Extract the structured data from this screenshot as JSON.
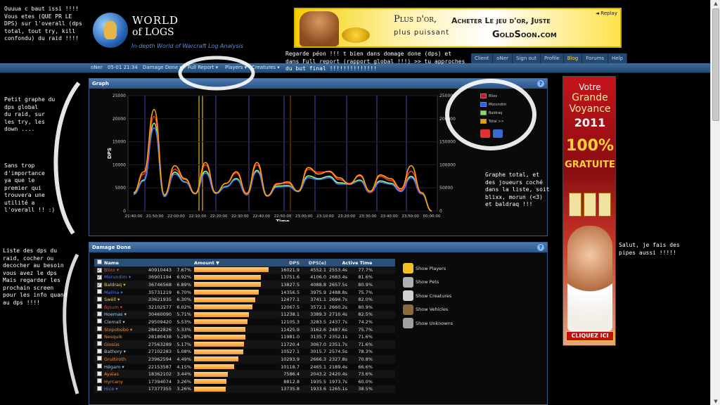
{
  "site": {
    "logo_line1": "WORLD",
    "logo_line2": "of LOGS",
    "tagline": "In-depth World of Warcraft Log Analysis"
  },
  "ad_top": {
    "line1": "Plus d'or,",
    "line2": "plus puissant",
    "line3": "Acheter Le jeu d'or, Juste",
    "line4": "GoldSoon.com",
    "replay": "◄ Replay"
  },
  "top_nav": [
    "Client",
    "oNer",
    "Sign out",
    "Profile",
    "Blog",
    "Forums",
    "Help"
  ],
  "breadcrumb": {
    "user": "oNer",
    "date": "05-01 21:34",
    "damage_done": "Damage Done ▾",
    "full_report": "Full Report ▾",
    "players": "Players ▾",
    "creatures": "Creatures ▾"
  },
  "graph": {
    "title": "Graph",
    "help": "?",
    "legend": [
      "Blixx",
      "Morundim",
      "Baldraq",
      "Total >>"
    ],
    "colors": {
      "Blixx": "#ff3040",
      "Morundim": "#3a7bff",
      "Baldraq": "#9cff70",
      "Total": "#ffa500"
    }
  },
  "chart_data": {
    "type": "line",
    "x": [
      "21:40:00",
      "21:50:00",
      "22:00:00",
      "22:10:00",
      "22:20:00",
      "22:30:00",
      "22:40:00",
      "22:50:00",
      "23:00:00",
      "23:10:00",
      "23:20:00",
      "23:30:00",
      "23:40:00",
      "23:50:00",
      "00:00:00"
    ],
    "xlabel": "Time",
    "ylabel": "DPS",
    "ylim": [
      0,
      25000
    ],
    "yticks": [
      0,
      5000,
      10000,
      15000,
      20000,
      25000
    ],
    "right_ylim": [
      0,
      250000
    ],
    "right_yticks": [
      0,
      50000,
      100000,
      150000,
      200000,
      250000
    ],
    "series": [
      {
        "name": "Total >>",
        "color": "#ffa500",
        "values": [
          4000,
          8500,
          22000,
          3500,
          9800,
          7000,
          3800,
          10500,
          3900,
          6000,
          8500,
          3800,
          10500,
          3300,
          5800,
          6300,
          4300,
          9400,
          8000,
          8600,
          7200,
          5800,
          7800,
          4300,
          7800,
          7000,
          4800,
          9800,
          4000,
          0
        ]
      },
      {
        "name": "Blixx",
        "color": "#ff3040",
        "values": [
          4000,
          8000,
          20500,
          3500,
          9000,
          6800,
          3800,
          10000,
          3900,
          6000,
          8200,
          3600,
          10000,
          3300,
          6000,
          6000,
          4300,
          9000,
          8400,
          8500,
          6800,
          6000,
          7600,
          4100,
          7500,
          6600,
          4500,
          8600,
          3900,
          0
        ]
      },
      {
        "name": "Morundim",
        "color": "#3a7bff",
        "values": [
          3600,
          6500,
          18000,
          3100,
          8000,
          6200,
          3700,
          8200,
          3800,
          5200,
          6800,
          3500,
          8500,
          3200,
          5200,
          5300,
          4200,
          7200,
          6800,
          7200,
          5800,
          5800,
          6500,
          4000,
          6200,
          5800,
          4200,
          7200,
          3700,
          0
        ]
      },
      {
        "name": "Baldraq",
        "color": "#9cff70",
        "values": [
          3700,
          6700,
          19000,
          3200,
          8400,
          6300,
          3700,
          8600,
          3800,
          5300,
          7000,
          3500,
          8800,
          3200,
          5400,
          5500,
          4200,
          7600,
          7000,
          7500,
          6100,
          5900,
          6700,
          4000,
          6500,
          6000,
          4300,
          7500,
          3800,
          0
        ]
      }
    ]
  },
  "damage_done": {
    "title": "Damage Done",
    "help": "?",
    "headers": {
      "name": "Name",
      "amount": "Amount",
      "amount_sort": "▼",
      "dps": "DPS",
      "dpse": "DPS(e)",
      "active": "Active Time"
    },
    "rows": [
      {
        "checked": true,
        "name": "Blixx ▾",
        "color": "#ff4a3a",
        "amount": "40910443",
        "pct": "7.67%",
        "frac": 1.0,
        "dps": "16021.9",
        "dpse": "4552.1",
        "active": "2553.4s",
        "apct": "77.7%"
      },
      {
        "checked": true,
        "name": "Morundim ▾",
        "color": "#4a7cff",
        "amount": "36901194",
        "pct": "6.92%",
        "frac": 0.9,
        "dps": "13751.6",
        "dpse": "4106.0",
        "active": "2683.4s",
        "apct": "81.6%"
      },
      {
        "checked": true,
        "name": "Baldraq ▾",
        "color": "#e0d640",
        "amount": "36746568",
        "pct": "6.89%",
        "frac": 0.9,
        "dps": "13827.5",
        "dpse": "4088.8",
        "active": "2657.5s",
        "apct": "80.9%"
      },
      {
        "checked": false,
        "name": "Malina ▾",
        "color": "#4a7cff",
        "amount": "35731219",
        "pct": "6.70%",
        "frac": 0.87,
        "dps": "14356.5",
        "dpse": "3975.9",
        "active": "2488.8s",
        "apct": "75.7%"
      },
      {
        "checked": false,
        "name": "Swëll ▾",
        "color": "#e0d640",
        "amount": "33621935",
        "pct": "6.30%",
        "frac": 0.82,
        "dps": "12477.1",
        "dpse": "3741.1",
        "active": "2694.7s",
        "apct": "82.0%"
      },
      {
        "checked": false,
        "name": "Bpium ▾",
        "color": "#ff3a3a",
        "amount": "32102577",
        "pct": "6.02%",
        "frac": 0.78,
        "dps": "12067.5",
        "dpse": "3572.1",
        "active": "2660.2s",
        "apct": "80.9%"
      },
      {
        "checked": false,
        "name": "Hoemas ▾",
        "color": "#9ad0ff",
        "amount": "30460090",
        "pct": "5.71%",
        "frac": 0.74,
        "dps": "11238.1",
        "dpse": "3389.3",
        "active": "2710.4s",
        "apct": "82.5%"
      },
      {
        "checked": false,
        "name": "Clemall ▾",
        "color": "#9ad0ff",
        "amount": "29509420",
        "pct": "5.53%",
        "frac": 0.72,
        "dps": "12105.3",
        "dpse": "3283.5",
        "active": "2437.7s",
        "apct": "74.2%"
      },
      {
        "checked": false,
        "name": "Stopobobo ▾",
        "color": "#ff8a2a",
        "amount": "28422826",
        "pct": "5.33%",
        "frac": 0.69,
        "dps": "11425.9",
        "dpse": "3162.6",
        "active": "2487.6s",
        "apct": "75.7%"
      },
      {
        "checked": false,
        "name": "Nesquik",
        "color": "#ff8a2a",
        "amount": "28180438",
        "pct": "5.28%",
        "frac": 0.69,
        "dps": "11981.0",
        "dpse": "3135.7",
        "active": "2352.1s",
        "apct": "71.6%"
      },
      {
        "checked": false,
        "name": "Glosüs",
        "color": "#ff8a2a",
        "amount": "27563289",
        "pct": "5.17%",
        "frac": 0.67,
        "dps": "11720.4",
        "dpse": "3067.0",
        "active": "2351.7s",
        "apct": "71.6%"
      },
      {
        "checked": false,
        "name": "Bathory ▾",
        "color": "#d0d0d0",
        "amount": "27102283",
        "pct": "5.08%",
        "frac": 0.66,
        "dps": "10527.1",
        "dpse": "3015.7",
        "active": "2574.5s",
        "apct": "78.3%"
      },
      {
        "checked": false,
        "name": "Gruitiroth",
        "color": "#ff8a2a",
        "amount": "23962594",
        "pct": "4.49%",
        "frac": 0.59,
        "dps": "10293.9",
        "dpse": "2666.3",
        "active": "2327.8s",
        "apct": "70.8%"
      },
      {
        "checked": false,
        "name": "Hêgam ▾",
        "color": "#9ad0ff",
        "amount": "22153587",
        "pct": "4.15%",
        "frac": 0.54,
        "dps": "10118.7",
        "dpse": "2465.1",
        "active": "2189.4s",
        "apct": "66.6%"
      },
      {
        "checked": false,
        "name": "Ayalas",
        "color": "#ff8a2a",
        "amount": "18362102",
        "pct": "3.44%",
        "frac": 0.45,
        "dps": "7586.4",
        "dpse": "2043.2",
        "active": "2420.4s",
        "apct": "73.6%"
      },
      {
        "checked": false,
        "name": "Hyrcany",
        "color": "#ff8a2a",
        "amount": "17394074",
        "pct": "3.26%",
        "frac": 0.43,
        "dps": "8812.8",
        "dpse": "1935.5",
        "active": "1973.7s",
        "apct": "60.0%"
      },
      {
        "checked": false,
        "name": "Hice ▾",
        "color": "#4a7cff",
        "amount": "17377355",
        "pct": "3.26%",
        "frac": 0.42,
        "dps": "13735.8",
        "dpse": "1933.6",
        "active": "1265.1s",
        "apct": "38.5%"
      }
    ],
    "options": [
      {
        "label": "Show Players",
        "icon": "players-icon",
        "color": "#f0c020"
      },
      {
        "label": "Show Pets",
        "icon": "pets-icon",
        "color": "#b0b0b0"
      },
      {
        "label": "Show Creatures",
        "icon": "creatures-icon",
        "color": "#d0d0d0"
      },
      {
        "label": "Show Vehicles",
        "icon": "vehicles-icon",
        "color": "#8a6a3a"
      },
      {
        "label": "Show Unknowns",
        "icon": "unknowns-icon",
        "color": "#a0a0a0"
      }
    ]
  },
  "ad_side": {
    "line1": "Votre",
    "line2": "Grande",
    "line3": "Voyance",
    "line4": "2011",
    "line5": "100%",
    "line6": "GRATUITE",
    "button": "CLIQUEZ ICI"
  },
  "notes": {
    "n1": "Ouuua c baut issi !!!!\nVous etes (QUE PR LE\nDPS) sur l'overall (dps\ntotal, tout try, kill\nconfondu) du raid !!!!",
    "n2": "Regarde péon !!! t bien dans domage done (dps) et\ndans Full report (rapport global !!!) >> tu approches\ndu but final !!!!!!!!!!!!!!",
    "n3": "Petit graphe du\ndps global\ndu raid, sur\nles try, les\ndown ....",
    "n4": "Sans trop\nd'importance\nya que le\npremier qui\ntrouvera une\nutilité a\nl'overall !! :)",
    "n5": "Graphe total, et\ndes joueurs coché\ndans la liste, soit\nblixx, morun (<3)\net baldraq !!!",
    "n6": "Liste des dps du\nraid, cocher ou\ndecocher au besoin\nvous avez le dps\nMais regarder les\nprochain screen\npour les info quand\nau dps !!!!",
    "n7": "Salut, je fais des\npipes aussi !!!!!"
  }
}
